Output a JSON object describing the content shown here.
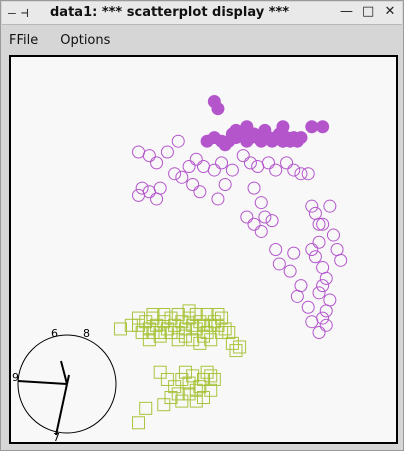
{
  "window": {
    "title": "data1: *** scatterplot display ***",
    "minimize_glyph": "—",
    "maximize_glyph": "□",
    "close_glyph": "✕",
    "menu_glyph": "—",
    "pin_glyph": "⊣"
  },
  "menu": {
    "items": [
      "FFile",
      "Options"
    ]
  },
  "colors": {
    "purple": "#b455cc",
    "green": "#a8c43c",
    "axes": "#000000",
    "frame": "#000000"
  },
  "chart_data": {
    "type": "scatter",
    "title": "",
    "xlabel": "",
    "ylabel": "",
    "xlim": [
      0,
      100
    ],
    "ylim": [
      0,
      100
    ],
    "series": [
      {
        "marker": "filled-circle",
        "color": "#b455cc",
        "points": [
          [
            53,
            91
          ],
          [
            54,
            89
          ],
          [
            51,
            80
          ],
          [
            53,
            81
          ],
          [
            55,
            80
          ],
          [
            57,
            80
          ],
          [
            58,
            82
          ],
          [
            59,
            81
          ],
          [
            61,
            82
          ],
          [
            62,
            80
          ],
          [
            63,
            81
          ],
          [
            64,
            82
          ],
          [
            65,
            81
          ],
          [
            66,
            80
          ],
          [
            67,
            82
          ],
          [
            68,
            81
          ],
          [
            69,
            80
          ],
          [
            70,
            81
          ],
          [
            71,
            82
          ],
          [
            72,
            80
          ],
          [
            73,
            81
          ],
          [
            74,
            80
          ],
          [
            75,
            81
          ],
          [
            76,
            80
          ],
          [
            77,
            81
          ],
          [
            62,
            84
          ],
          [
            67,
            83
          ],
          [
            72,
            84
          ],
          [
            80,
            84
          ],
          [
            83,
            84
          ],
          [
            59,
            83
          ],
          [
            56,
            79
          ]
        ]
      },
      {
        "marker": "open-circle",
        "color": "#b455cc",
        "points": [
          [
            32,
            77
          ],
          [
            35,
            76
          ],
          [
            37,
            74
          ],
          [
            40,
            77
          ],
          [
            43,
            80
          ],
          [
            46,
            73
          ],
          [
            44,
            70
          ],
          [
            42,
            71
          ],
          [
            48,
            75
          ],
          [
            50,
            73
          ],
          [
            53,
            72
          ],
          [
            55,
            74
          ],
          [
            58,
            72
          ],
          [
            61,
            76
          ],
          [
            63,
            74
          ],
          [
            65,
            73
          ],
          [
            68,
            74
          ],
          [
            70,
            72
          ],
          [
            73,
            74
          ],
          [
            75,
            72
          ],
          [
            77,
            71
          ],
          [
            79,
            71
          ],
          [
            72,
            80
          ],
          [
            32,
            65
          ],
          [
            33,
            67
          ],
          [
            35,
            66
          ],
          [
            37,
            64
          ],
          [
            38,
            67
          ],
          [
            47,
            68
          ],
          [
            49,
            66
          ],
          [
            54,
            64
          ],
          [
            56,
            68
          ],
          [
            64,
            67
          ],
          [
            66,
            63
          ],
          [
            67,
            59
          ],
          [
            62,
            59
          ],
          [
            64,
            57
          ],
          [
            80,
            62
          ],
          [
            81,
            60
          ],
          [
            82,
            57
          ],
          [
            82,
            52
          ],
          [
            80,
            50
          ],
          [
            81,
            48
          ],
          [
            83,
            45
          ],
          [
            84,
            42
          ],
          [
            83,
            40
          ],
          [
            82,
            38
          ],
          [
            85,
            36
          ],
          [
            84,
            33
          ],
          [
            83,
            31
          ],
          [
            84,
            29
          ],
          [
            82,
            27
          ],
          [
            80,
            30
          ],
          [
            77,
            40
          ],
          [
            76,
            37
          ],
          [
            79,
            34
          ],
          [
            74,
            44
          ],
          [
            71,
            46
          ],
          [
            70,
            50
          ],
          [
            66,
            55
          ],
          [
            69,
            58
          ],
          [
            75,
            49
          ],
          [
            83,
            57
          ],
          [
            85,
            62
          ],
          [
            87,
            50
          ],
          [
            86,
            54
          ],
          [
            88,
            47
          ]
        ]
      },
      {
        "marker": "open-square",
        "color": "#a8c43c",
        "points": [
          [
            27,
            28
          ],
          [
            30,
            29
          ],
          [
            32,
            29
          ],
          [
            34,
            30
          ],
          [
            35,
            28
          ],
          [
            36,
            31
          ],
          [
            37,
            29
          ],
          [
            38,
            27
          ],
          [
            39,
            30
          ],
          [
            40,
            28
          ],
          [
            41,
            31
          ],
          [
            42,
            29
          ],
          [
            43,
            27
          ],
          [
            44,
            30
          ],
          [
            45,
            28
          ],
          [
            46,
            31
          ],
          [
            47,
            29
          ],
          [
            48,
            28
          ],
          [
            49,
            30
          ],
          [
            50,
            29
          ],
          [
            51,
            27
          ],
          [
            52,
            29
          ],
          [
            53,
            30
          ],
          [
            54,
            29
          ],
          [
            55,
            31
          ],
          [
            56,
            28
          ],
          [
            57,
            27
          ],
          [
            58,
            24
          ],
          [
            59,
            22
          ],
          [
            60,
            23
          ],
          [
            33,
            27
          ],
          [
            35,
            25
          ],
          [
            36,
            27
          ],
          [
            38,
            26
          ],
          [
            41,
            27
          ],
          [
            43,
            25
          ],
          [
            45,
            26
          ],
          [
            47,
            25
          ],
          [
            49,
            24
          ],
          [
            50,
            26
          ],
          [
            52,
            25
          ],
          [
            55,
            27
          ],
          [
            32,
            31
          ],
          [
            36,
            32
          ],
          [
            39,
            32
          ],
          [
            43,
            32
          ],
          [
            46,
            33
          ],
          [
            48,
            32
          ],
          [
            51,
            32
          ],
          [
            54,
            32
          ],
          [
            38,
            16
          ],
          [
            40,
            14
          ],
          [
            42,
            12
          ],
          [
            44,
            14
          ],
          [
            45,
            16
          ],
          [
            46,
            13
          ],
          [
            47,
            15
          ],
          [
            48,
            11
          ],
          [
            49,
            12
          ],
          [
            50,
            14
          ],
          [
            51,
            16
          ],
          [
            52,
            15
          ],
          [
            53,
            14
          ],
          [
            52,
            11
          ],
          [
            50,
            9
          ],
          [
            48,
            8
          ],
          [
            46,
            10
          ],
          [
            44,
            8
          ],
          [
            43,
            10
          ],
          [
            41,
            9
          ],
          [
            39,
            7
          ],
          [
            34,
            6
          ],
          [
            32,
            2
          ]
        ]
      }
    ]
  },
  "clock_labels": {
    "top_left": "6",
    "top_right": "8",
    "left": "9",
    "bottom": "7"
  }
}
